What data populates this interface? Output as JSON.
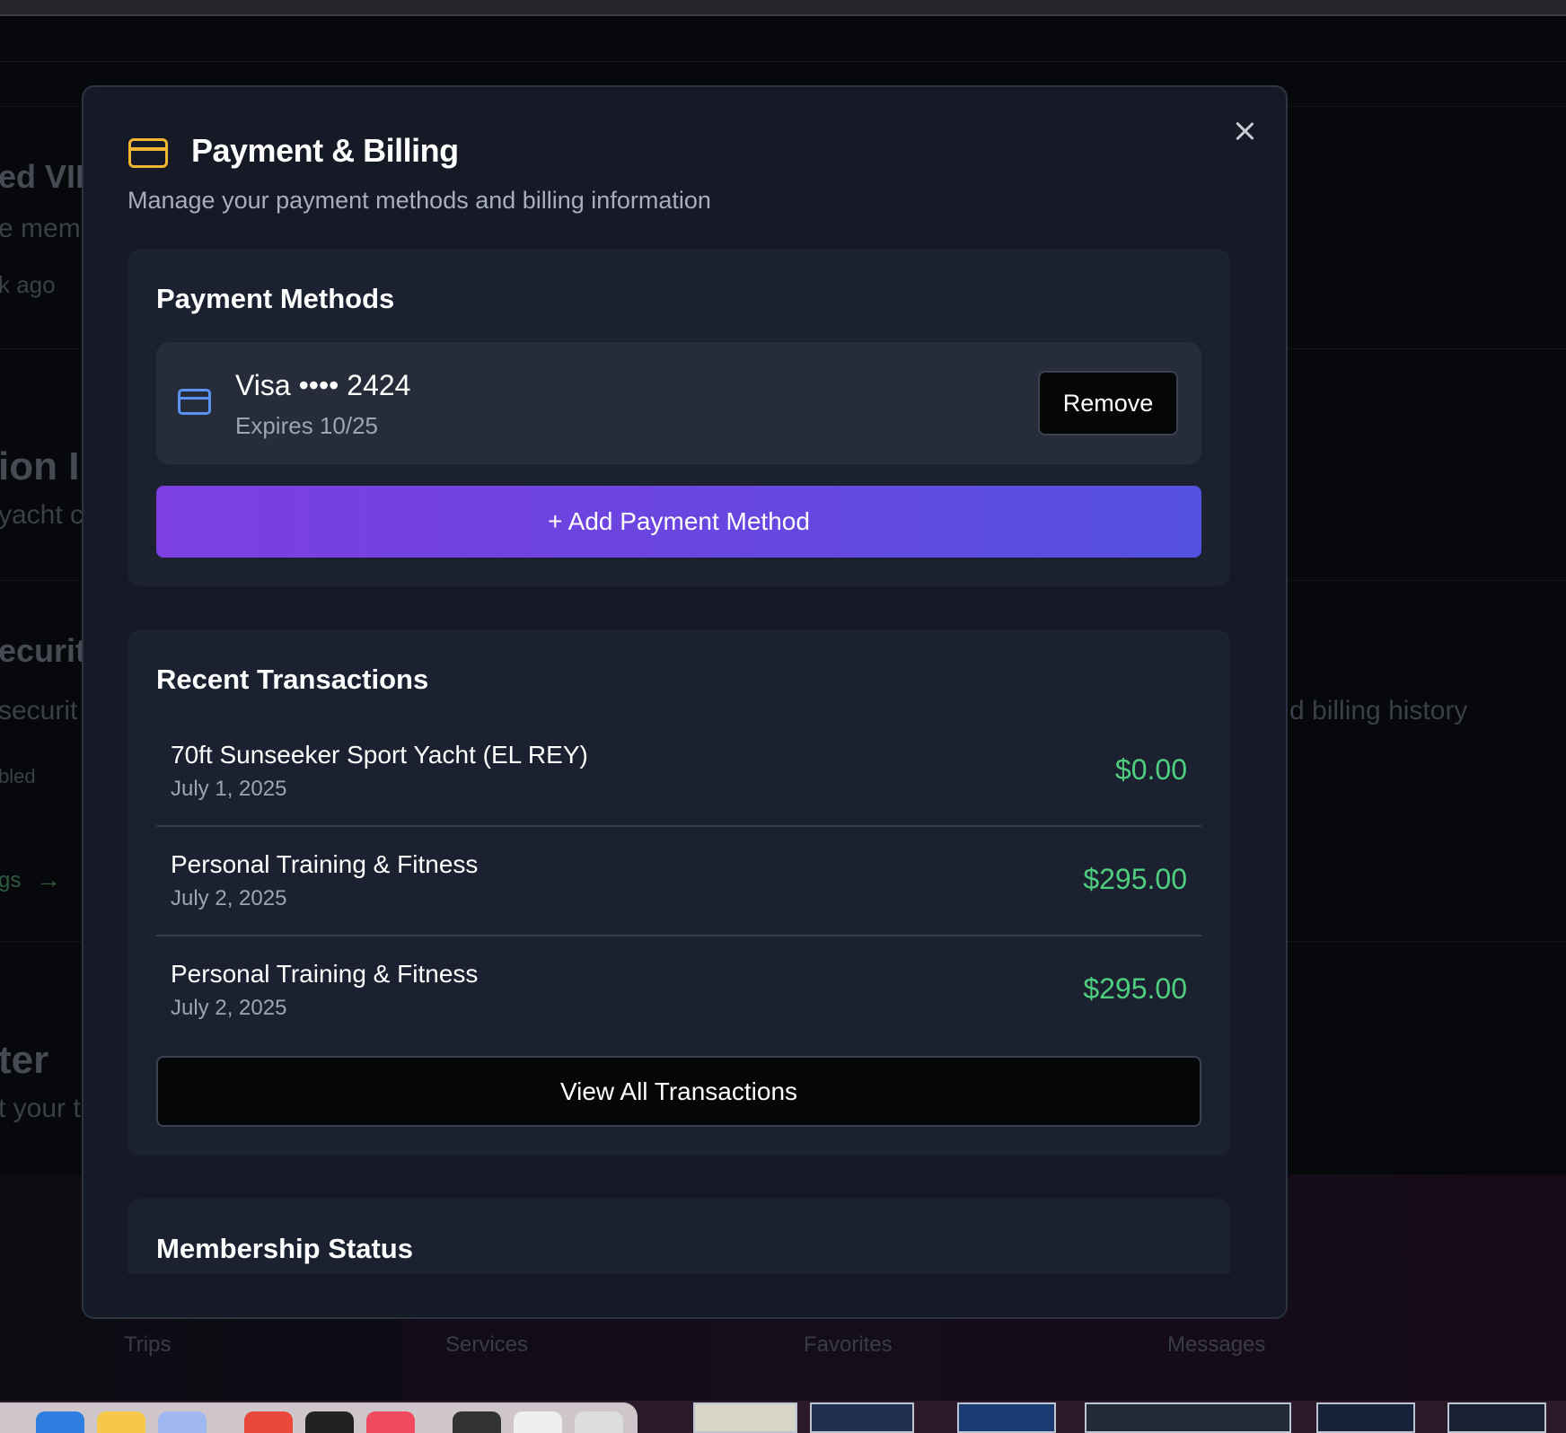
{
  "modal": {
    "title": "Payment & Billing",
    "subtitle": "Manage your payment methods and billing information",
    "close_icon": "close-icon",
    "header_icon": "credit-card-icon"
  },
  "payment_methods": {
    "title": "Payment Methods",
    "cards": [
      {
        "icon": "credit-card-icon",
        "name": "Visa •••• 2424",
        "expires": "Expires 10/25",
        "remove_label": "Remove"
      }
    ],
    "add_label": "+ Add Payment Method"
  },
  "transactions": {
    "title": "Recent Transactions",
    "items": [
      {
        "name": "70ft Sunseeker Sport Yacht (EL REY)",
        "date": "July 1, 2025",
        "amount": "$0.00"
      },
      {
        "name": "Personal Training & Fitness",
        "date": "July 2, 2025",
        "amount": "$295.00"
      },
      {
        "name": "Personal Training & Fitness",
        "date": "July 2, 2025",
        "amount": "$295.00"
      }
    ],
    "view_all_label": "View All Transactions"
  },
  "membership": {
    "title": "Membership Status"
  },
  "background": {
    "fragments": [
      "ed VIP",
      "e mem",
      "k ago",
      "ion I",
      "yacht c",
      "ecurit",
      "securit",
      "bled",
      "gs",
      "ter",
      "t your t",
      "d billing history"
    ],
    "nav": [
      "Trips",
      "Services",
      "Favorites",
      "Messages"
    ]
  },
  "colors": {
    "accent_gold": "#f2b531",
    "accent_blue": "#5a93f2",
    "amount_green": "#4fcf7e",
    "button_gradient_start": "#7d3fe0",
    "button_gradient_end": "#5451e0"
  }
}
